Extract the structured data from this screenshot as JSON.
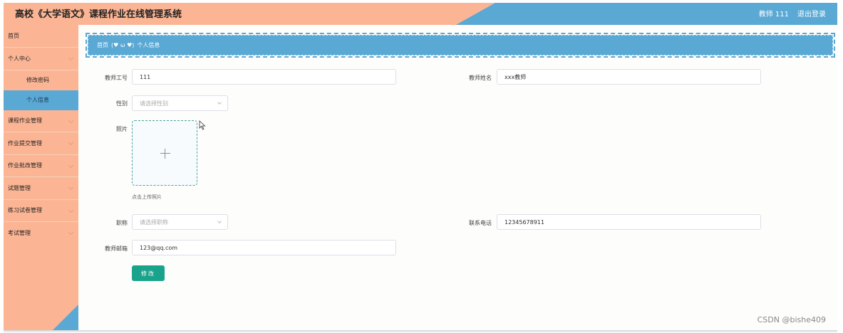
{
  "header": {
    "title": "高校《大学语文》课程作业在线管理系统",
    "user": "教师 111",
    "logout": "退出登录"
  },
  "sidebar": {
    "items": [
      {
        "label": "首页"
      },
      {
        "label": "个人中心"
      },
      {
        "label": "修改密码"
      },
      {
        "label": "个人信息"
      },
      {
        "label": "课程作业管理"
      },
      {
        "label": "作业提交管理"
      },
      {
        "label": "作业批改管理"
      },
      {
        "label": "试题管理"
      },
      {
        "label": "练习试卷管理"
      },
      {
        "label": "考试管理"
      }
    ]
  },
  "breadcrumb": {
    "home": "首页",
    "separator": "(♥ ω ♥)",
    "current": "个人信息"
  },
  "form": {
    "teacher_id": {
      "label": "教师工号",
      "value": "111"
    },
    "teacher_name": {
      "label": "教师姓名",
      "value": "xxx教师"
    },
    "gender": {
      "label": "性别",
      "placeholder": "请选择性别"
    },
    "photo": {
      "label": "照片",
      "tip": "点击上传照片"
    },
    "title": {
      "label": "职称",
      "placeholder": "请选择职称"
    },
    "phone": {
      "label": "联系电话",
      "value": "12345678911"
    },
    "email": {
      "label": "教师邮箱",
      "value": "123@qq.com"
    },
    "submit": "修改"
  },
  "watermark": "CSDN @bishe409",
  "colors": {
    "orange": "#fcb594",
    "blue": "#5aa8d4",
    "button": "#1aa38b"
  }
}
